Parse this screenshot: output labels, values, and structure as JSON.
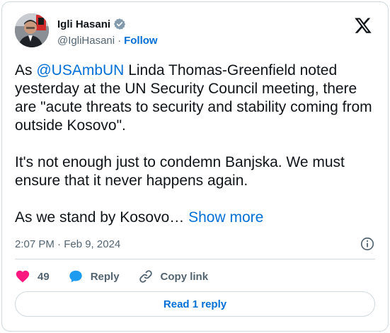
{
  "author": {
    "display_name": "Igli Hasani",
    "handle": "@IgliHasani",
    "follow_label": "Follow",
    "separator": "·"
  },
  "tweet": {
    "prefix": "As ",
    "mention": "@USAmbUN",
    "body": " Linda Thomas-Greenfield noted yesterday at the UN Security Council meeting, there are \"acute threats to security and stability coming from outside Kosovo\".\n\nIt's not enough just to condemn Banjska. We must ensure that it never happens again.\n\nAs we stand by Kosovo… ",
    "show_more": "Show more"
  },
  "meta": {
    "timestamp": "2:07 PM · Feb 9, 2024"
  },
  "actions": {
    "like_count": "49",
    "reply_label": "Reply",
    "copy_link_label": "Copy link"
  },
  "read_replies_label": "Read 1 reply",
  "colors": {
    "like": "#f91880",
    "accent": "#1d9bf0",
    "link": "#006fd6",
    "muted": "#536471"
  },
  "icons": [
    "verified-badge-icon",
    "x-logo-icon",
    "info-icon",
    "heart-icon",
    "reply-icon",
    "link-icon"
  ]
}
